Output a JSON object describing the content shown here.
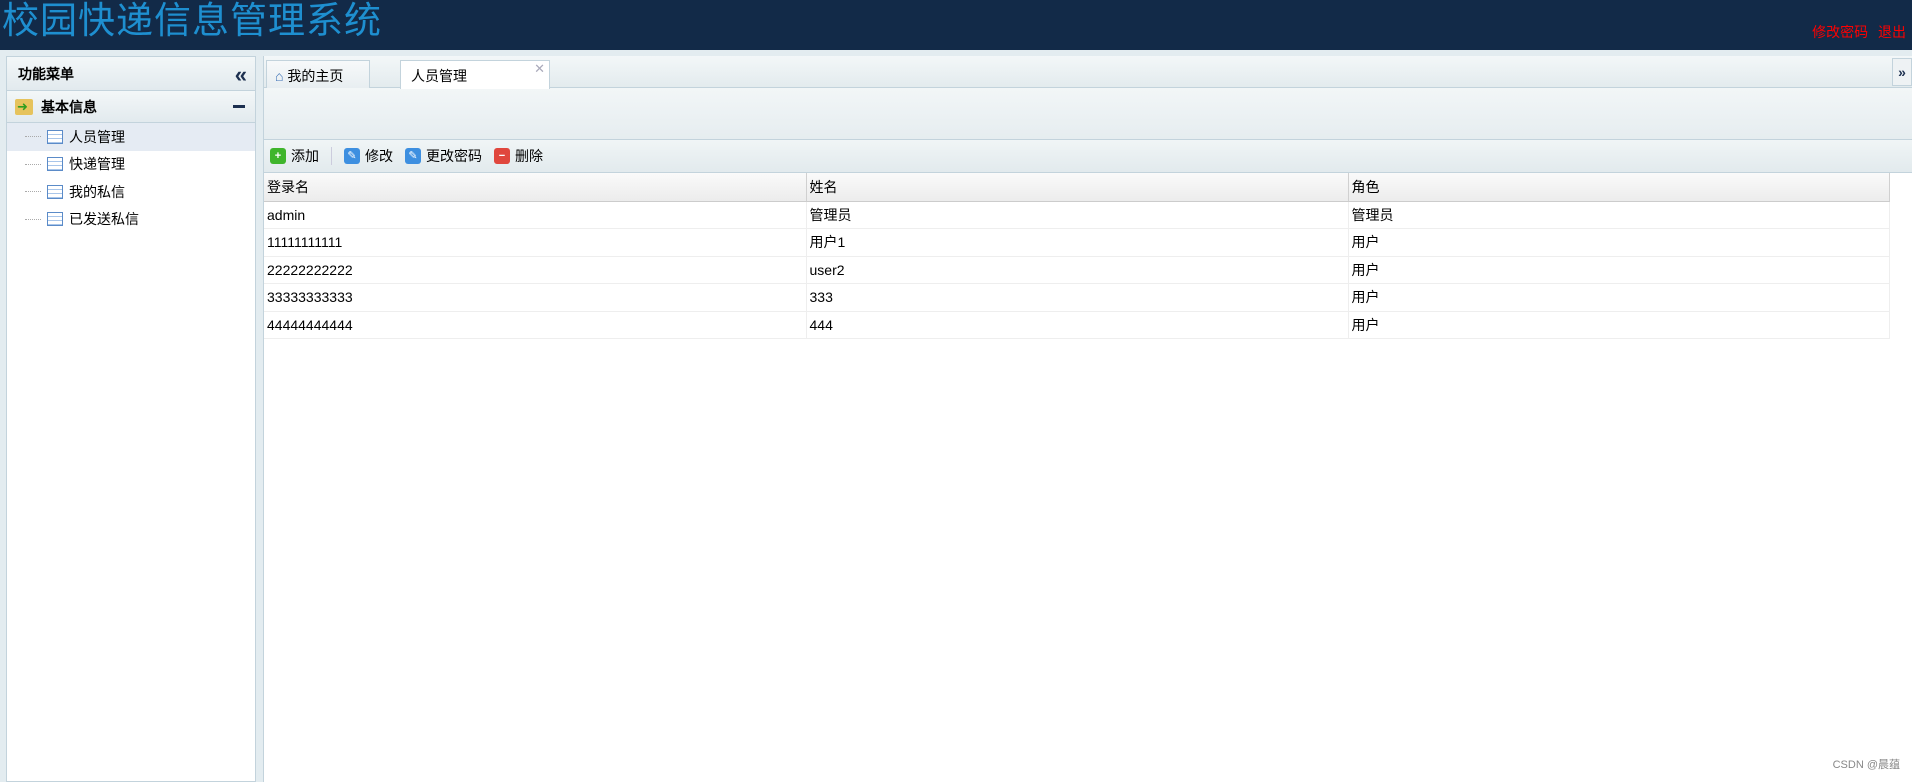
{
  "header": {
    "title": "校园快递信息管理系统",
    "change_password": "修改密码",
    "logout": "退出"
  },
  "sidebar": {
    "title": "功能菜单",
    "group": "基本信息",
    "items": [
      {
        "label": "人员管理"
      },
      {
        "label": "快递管理"
      },
      {
        "label": "我的私信"
      },
      {
        "label": "已发送私信"
      }
    ]
  },
  "tabs": [
    {
      "label": "我的主页"
    },
    {
      "label": "人员管理"
    }
  ],
  "toolbar": {
    "add": "添加",
    "edit": "修改",
    "change_password": "更改密码",
    "delete": "删除"
  },
  "table": {
    "columns": [
      "登录名",
      "姓名",
      "角色"
    ],
    "rows": [
      [
        "admin",
        "管理员",
        "管理员"
      ],
      [
        "11111111111",
        "用户1",
        "用户"
      ],
      [
        "22222222222",
        "user2",
        "用户"
      ],
      [
        "33333333333",
        "333",
        "用户"
      ],
      [
        "44444444444",
        "444",
        "用户"
      ]
    ]
  },
  "watermark": "CSDN @晨蕴"
}
